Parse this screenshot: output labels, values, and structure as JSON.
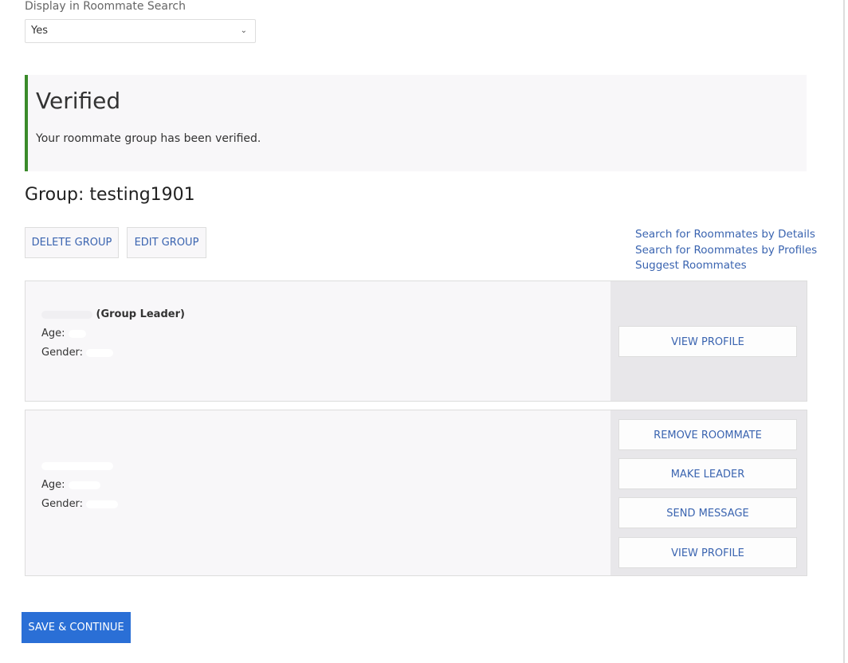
{
  "display_search": {
    "label": "Display in Roommate Search",
    "value": "Yes"
  },
  "alert": {
    "title": "Verified",
    "message": "Your roommate group has been verified.",
    "accent": "#3a8a2a"
  },
  "group": {
    "title": "Group: testing1901",
    "delete_label": "DELETE GROUP",
    "edit_label": "EDIT GROUP"
  },
  "links": [
    "Search for Roommates by Details",
    "Search for Roommates by Profiles",
    "Suggest Roommates"
  ],
  "members": [
    {
      "name_suffix": "(Group Leader)",
      "age_label": "Age:",
      "gender_label": "Gender:",
      "actions": [
        "VIEW PROFILE"
      ]
    },
    {
      "name_suffix": "",
      "age_label": "Age:",
      "gender_label": "Gender:",
      "actions": [
        "REMOVE ROOMMATE",
        "MAKE LEADER",
        "SEND MESSAGE",
        "VIEW PROFILE"
      ]
    }
  ],
  "save_label": "SAVE & CONTINUE",
  "colors": {
    "link": "#3a64b0",
    "primary": "#2a6fd6"
  }
}
